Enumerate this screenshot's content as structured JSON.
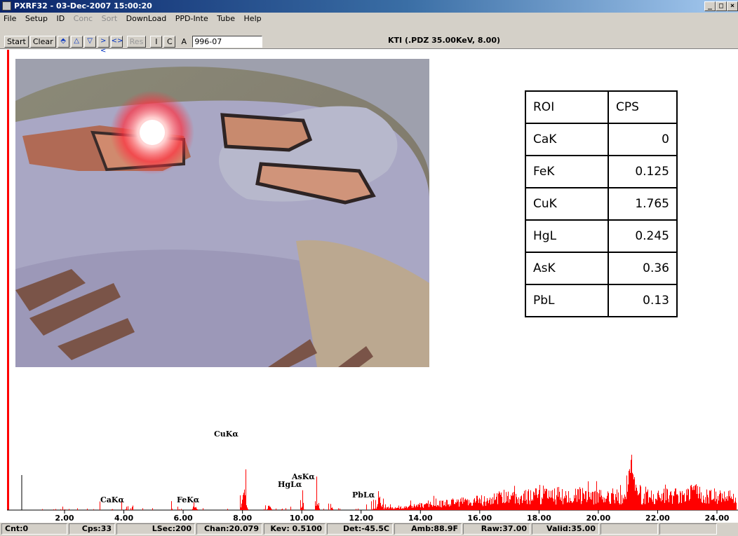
{
  "window": {
    "title": "PXRF32 - 03-Dec-2007 15:00:20"
  },
  "menu": [
    "File",
    "Setup",
    "ID",
    "Conc",
    "Sort",
    "DownLoad",
    "PPD-Inte",
    "Tube",
    "Help"
  ],
  "toolbar": {
    "start": "Start",
    "clear": "Clear",
    "res": "Res",
    "i": "I",
    "c": "C",
    "a": "A",
    "sample_id": "996-07",
    "status_text": "KTI (.PDZ 35.00KeV, 8.00)"
  },
  "roi_table": {
    "headers": [
      "ROI",
      "CPS"
    ],
    "rows": [
      {
        "roi": "CaK",
        "cps": "0"
      },
      {
        "roi": "FeK",
        "cps": "0.125"
      },
      {
        "roi": "CuK",
        "cps": "1.765"
      },
      {
        "roi": "HgL",
        "cps": "0.245"
      },
      {
        "roi": "AsK",
        "cps": "0.36"
      },
      {
        "roi": "PbL",
        "cps": "0.13"
      }
    ]
  },
  "spectrum": {
    "x_ticks": [
      "2.00",
      "4.00",
      "6.00",
      "8.00",
      "10.00",
      "12.00",
      "14.00",
      "16.00",
      "18.00",
      "20.00",
      "22.00",
      "24.00"
    ],
    "peak_labels": [
      "CaKα",
      "FeKα",
      "CuKα",
      "HgLα",
      "AsKα",
      "PbLα"
    ],
    "bar_color": "#ff0000"
  },
  "status": {
    "cnt": "Cnt:0",
    "cps": "Cps:33",
    "lsec": "LSec:200",
    "chan": "Chan:20.079",
    "kev": "Kev: 0.5100",
    "det": "Det:-45.5C",
    "amb": "Amb:88.9F",
    "raw": "Raw:37.00",
    "valid": "Valid:35.00"
  }
}
